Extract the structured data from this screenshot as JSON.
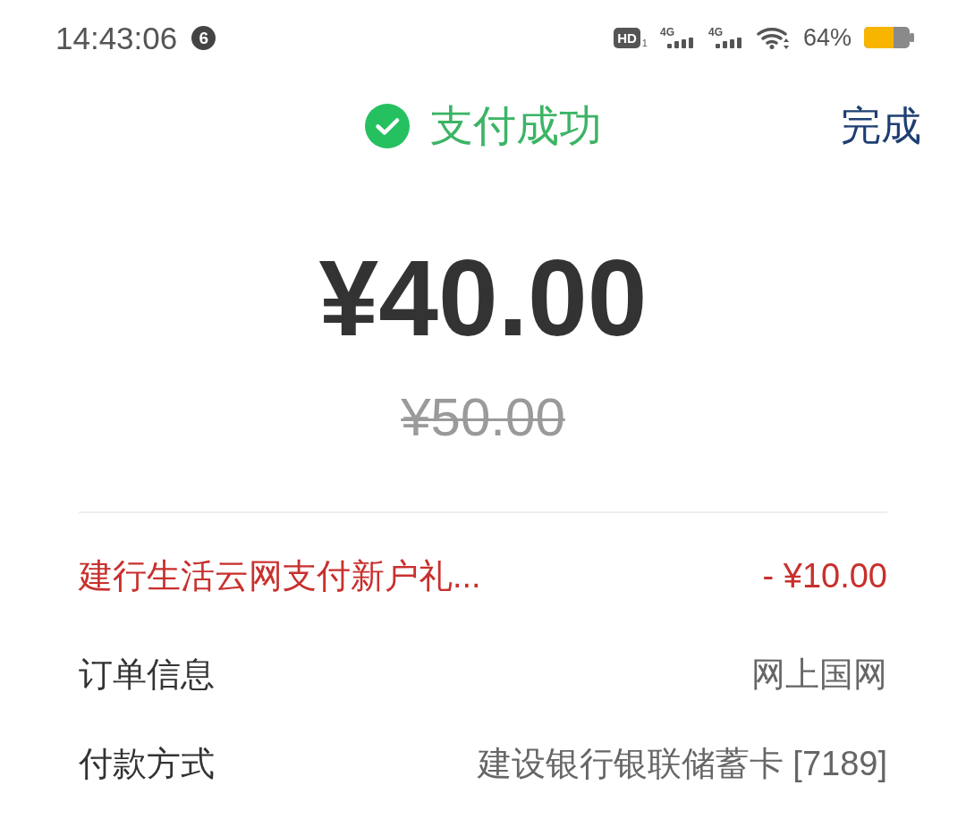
{
  "status_bar": {
    "time": "14:43:06",
    "notification_badge": "6",
    "indicators": [
      {
        "kind": "hd",
        "label": "HD",
        "sub": "1"
      },
      {
        "kind": "cellular",
        "label": "4G"
      },
      {
        "kind": "cellular",
        "label": "4G"
      },
      {
        "kind": "wifi"
      }
    ],
    "battery_percent": "64%"
  },
  "header": {
    "title": "支付成功",
    "done_button": "完成"
  },
  "payment": {
    "amount": "¥40.00",
    "original_amount": "¥50.00"
  },
  "details": [
    {
      "kind": "discount",
      "label": "建行生活云网支付新户礼...",
      "value": "- ¥10.00"
    },
    {
      "kind": "info",
      "label": "订单信息",
      "value": "网上国网"
    },
    {
      "kind": "info",
      "label": "付款方式",
      "value": "建设银行银联储蓄卡 [7189]"
    }
  ]
}
